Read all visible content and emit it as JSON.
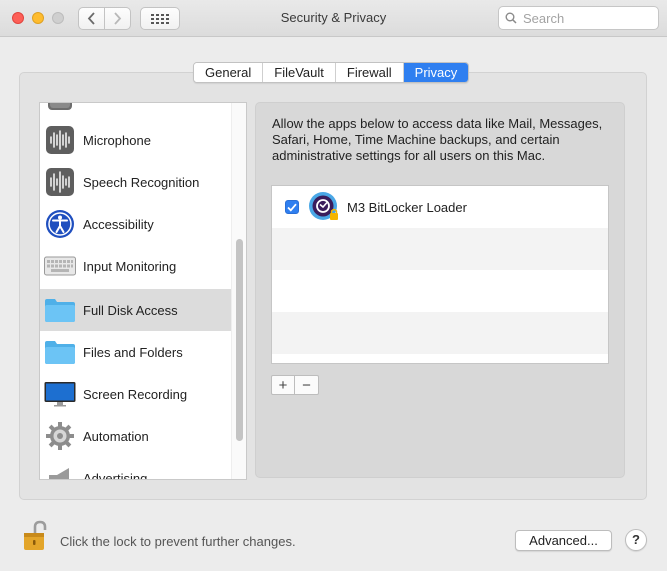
{
  "window": {
    "title": "Security & Privacy",
    "search_placeholder": "Search"
  },
  "tabs": [
    {
      "label": "General",
      "active": false
    },
    {
      "label": "FileVault",
      "active": false
    },
    {
      "label": "Firewall",
      "active": false
    },
    {
      "label": "Privacy",
      "active": true
    }
  ],
  "sidebar": {
    "items": [
      {
        "label": "Microphone",
        "icon": "microphone-icon"
      },
      {
        "label": "Speech Recognition",
        "icon": "speech-recognition-icon"
      },
      {
        "label": "Accessibility",
        "icon": "accessibility-icon"
      },
      {
        "label": "Input Monitoring",
        "icon": "keyboard-icon"
      },
      {
        "label": "Full Disk Access",
        "icon": "folder-icon",
        "selected": true
      },
      {
        "label": "Files and Folders",
        "icon": "folder-icon"
      },
      {
        "label": "Screen Recording",
        "icon": "display-icon"
      },
      {
        "label": "Automation",
        "icon": "gear-icon"
      },
      {
        "label": "Advertising",
        "icon": "megaphone-icon"
      }
    ]
  },
  "main": {
    "description": "Allow the apps below to access data like Mail, Messages, Safari, Home, Time Machine backups, and certain administrative settings for all users on this Mac.",
    "apps": [
      {
        "name": "M3 BitLocker Loader",
        "checked": true
      }
    ],
    "add_label": "+",
    "remove_label": "−"
  },
  "footer": {
    "lock_text": "Click the lock to prevent further changes.",
    "advanced_label": "Advanced...",
    "help_label": "?"
  },
  "colors": {
    "accent": "#2f7ff0",
    "selected_row": "#dcdcdc",
    "window_bg": "#ececec"
  }
}
